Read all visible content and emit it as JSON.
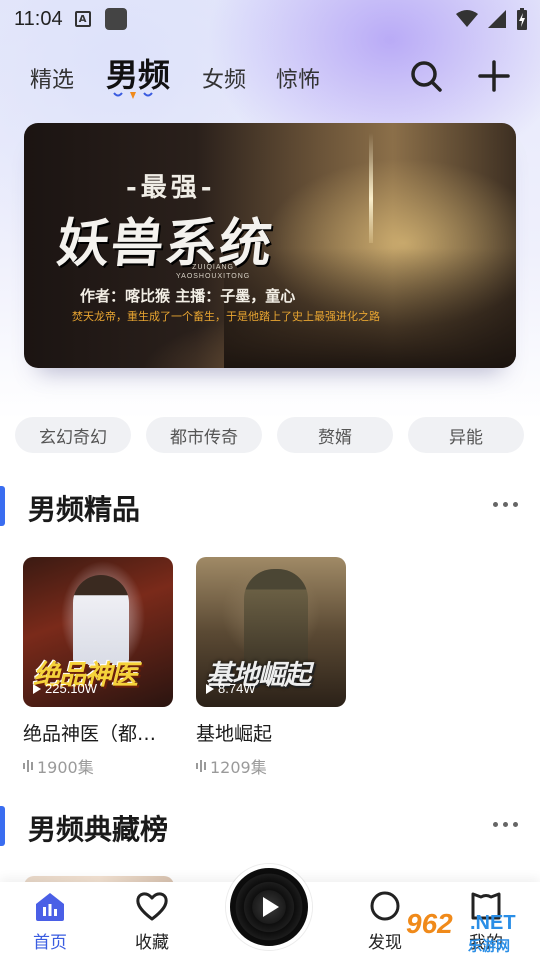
{
  "status_bar": {
    "time": "11:04",
    "input_indicator": "A"
  },
  "nav": {
    "tabs": [
      {
        "label": "精选",
        "active": false
      },
      {
        "label": "男频",
        "active": true
      },
      {
        "label": "女频",
        "active": false
      },
      {
        "label": "惊怖",
        "active": false
      }
    ],
    "search_icon": "search-icon",
    "add_icon": "plus-icon"
  },
  "banner": {
    "subtitle": "-最强-",
    "title": "妖兽系统",
    "pinyin_1": "ZUIQIANG",
    "pinyin_2": "YAOSHOUXITONG",
    "credits": "作者：喀比猴  主播：子墨，童心",
    "tagline": "焚天龙帝，重生成了一个畜生，于是他踏上了史上最强进化之路"
  },
  "categories": [
    "玄幻奇幻",
    "都市传奇",
    "赘婿",
    "异能"
  ],
  "sections": {
    "featured": {
      "title": "男频精品",
      "more_icon": "more-dots-icon"
    },
    "ranking": {
      "title": "男频典藏榜",
      "more_icon": "more-dots-icon"
    }
  },
  "books": [
    {
      "title": "绝品神医（都…",
      "cover_logo": "绝品神医",
      "plays": "225.10W",
      "episodes": "1900集"
    },
    {
      "title": "基地崛起",
      "cover_logo": "基地崛起",
      "plays": "8.74W",
      "episodes": "1209集"
    }
  ],
  "bottom_nav": {
    "items": [
      {
        "label": "首页",
        "icon": "home-icon",
        "active": true
      },
      {
        "label": "收藏",
        "icon": "heart-icon",
        "active": false
      },
      {
        "label": "发现",
        "icon": "discover-icon",
        "active": false
      },
      {
        "label": "我的",
        "icon": "profile-icon",
        "active": false
      }
    ],
    "player_icon": "play-icon"
  },
  "watermark": {
    "number": "962",
    "net": ".NET",
    "site": "乐游网"
  },
  "colors": {
    "accent": "#3a5ce0",
    "section_bar": "#3a6df0",
    "tab_indicator": "#f08a1a"
  }
}
